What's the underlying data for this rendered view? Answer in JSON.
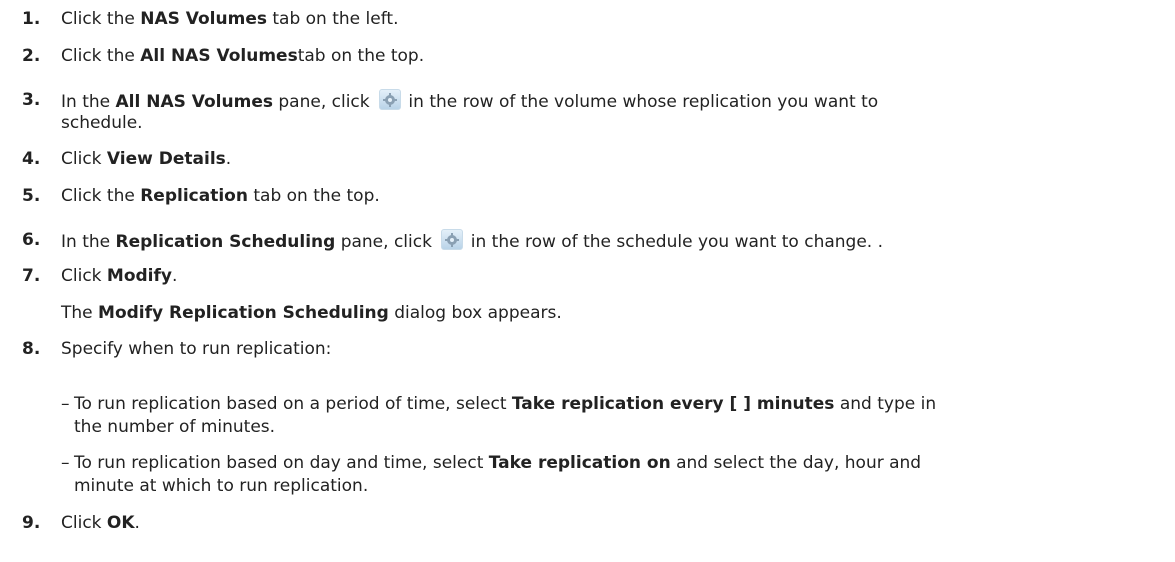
{
  "steps": [
    {
      "num": "1.",
      "parts": [
        "Click the ",
        "NAS Volumes",
        " tab on the left."
      ]
    },
    {
      "num": "2.",
      "parts": [
        "Click the ",
        "All NAS Volumes",
        "tab on the top."
      ]
    },
    {
      "num": "3.",
      "parts": [
        "In the ",
        "All NAS Volumes",
        " pane, click ",
        " in the row of the volume whose replication you want to",
        "schedule."
      ]
    },
    {
      "num": "4.",
      "parts": [
        "Click ",
        "View Details",
        "."
      ]
    },
    {
      "num": "5.",
      "parts": [
        "Click the ",
        "Replication",
        " tab on the top."
      ]
    },
    {
      "num": "6.",
      "parts": [
        "In the ",
        "Replication Scheduling",
        " pane, click ",
        " in the row of the schedule you want to change. ."
      ]
    },
    {
      "num": "7.",
      "parts": [
        "Click ",
        "Modify",
        "."
      ]
    },
    {
      "num": "8.",
      "parts": [
        "Specify when to run replication:"
      ]
    },
    {
      "num": "9.",
      "parts": [
        "Click ",
        "OK",
        "."
      ]
    }
  ],
  "step7_note": [
    "The ",
    "Modify Replication Scheduling",
    " dialog box appears."
  ],
  "dash": "–",
  "sub_items": [
    {
      "parts": [
        "To run replication based on a period of time, select ",
        "Take replication every [ ] minutes",
        " and type in",
        "the number of minutes."
      ]
    },
    {
      "parts": [
        "To run replication based on day and time, select ",
        "Take replication on",
        " and select the day, hour and",
        "minute at which to run replication."
      ]
    }
  ],
  "icons": {
    "settings": "gear-icon"
  }
}
